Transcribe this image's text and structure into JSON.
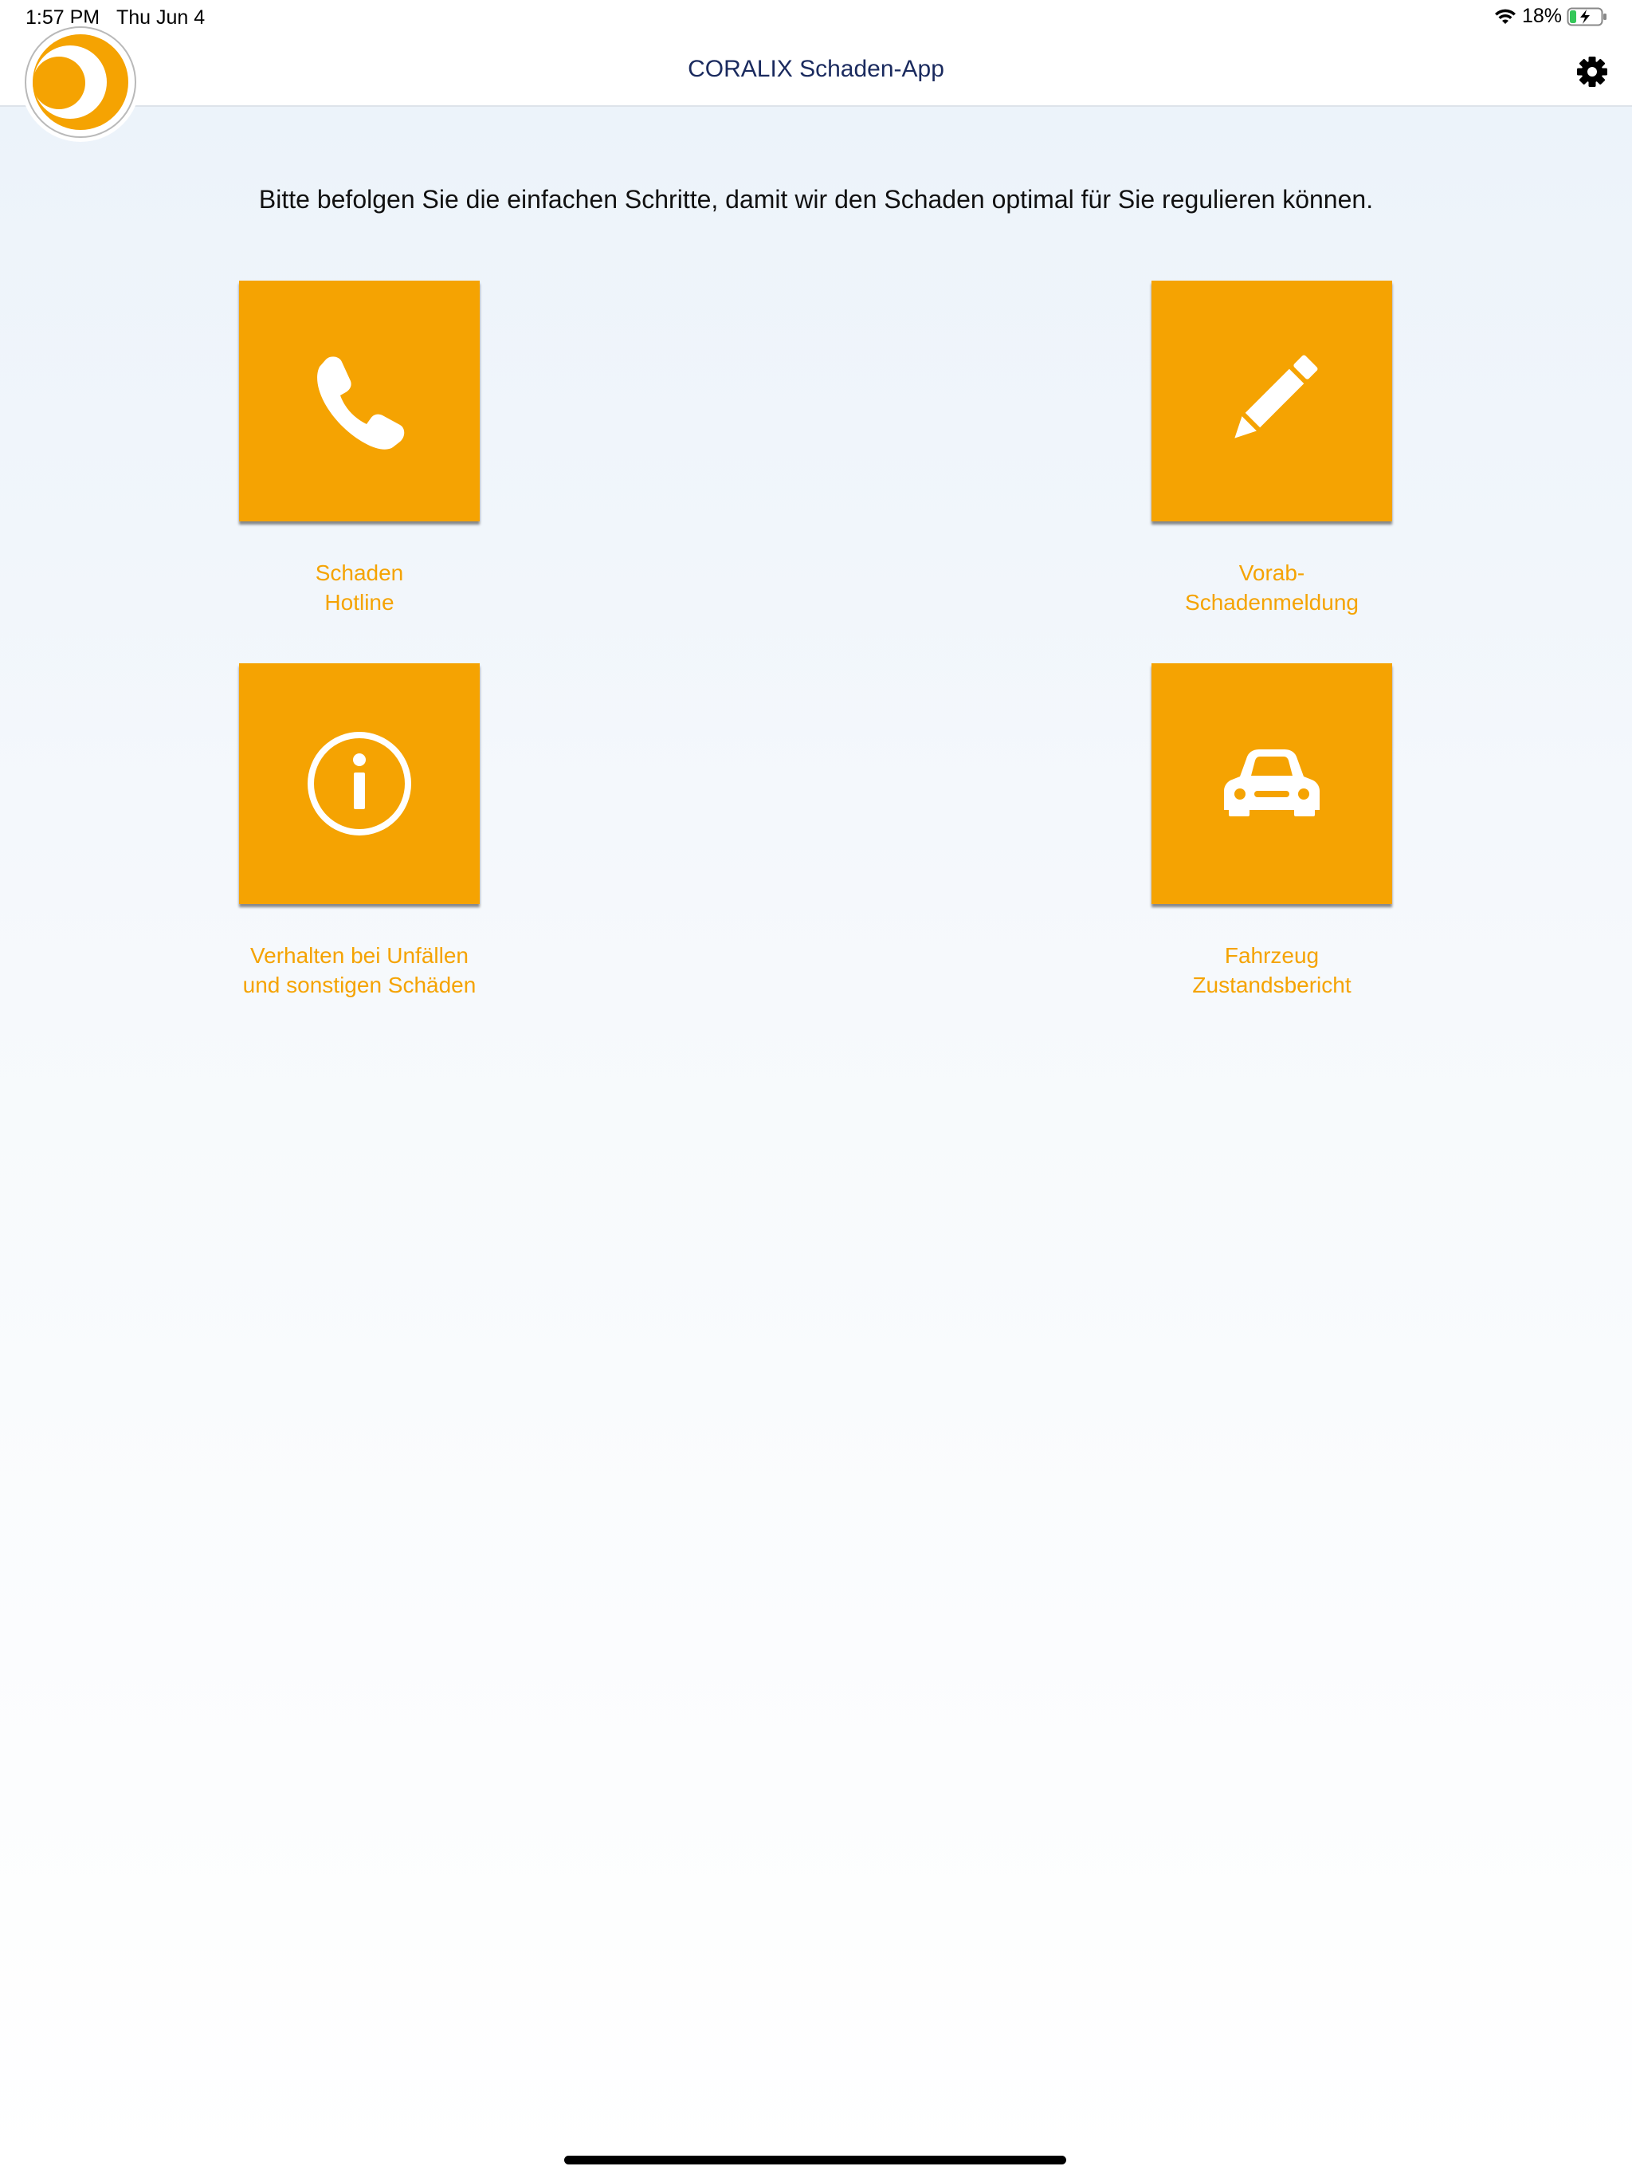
{
  "status_bar": {
    "time": "1:57 PM",
    "date": "Thu Jun 4",
    "battery": "18%",
    "battery_level": 0.18,
    "icons": [
      "wifi-icon",
      "battery-charging-icon"
    ]
  },
  "nav": {
    "title": "CORALIX Schaden-App",
    "settings_icon": "gear-icon",
    "logo": "coralix-logo"
  },
  "intro_text": "Bitte befolgen Sie die einfachen Schritte, damit wir den Schaden optimal für Sie regulieren können.",
  "tiles": [
    {
      "label": "Schaden\nHotline",
      "icon": "phone-icon"
    },
    {
      "label": "Vorab-\nSchadenmeldung",
      "icon": "pencil-icon"
    },
    {
      "label": "Verhalten bei Unfällen\nund sonstigen Schäden",
      "icon": "info-icon"
    },
    {
      "label": "Fahrzeug\nZustandsbericht",
      "icon": "car-icon"
    }
  ],
  "colors": {
    "accent": "#f5a302",
    "title": "#1a2a5e",
    "battery_charging": "#34c759"
  }
}
